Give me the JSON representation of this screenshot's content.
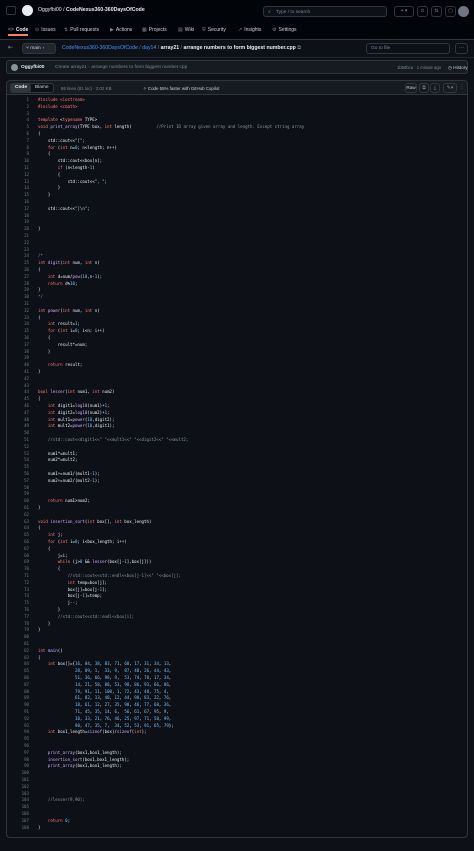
{
  "header": {
    "owner": "Oggyfbi00",
    "repo": "CodeNexus360-360DaysOfCode",
    "search_placeholder": "Type / to search",
    "plus_label": "+",
    "tabs": [
      {
        "icon": "<>",
        "label": "Code",
        "active": true
      },
      {
        "icon": "⊙",
        "label": "Issues",
        "active": false
      },
      {
        "icon": "⇅",
        "label": "Pull requests",
        "active": false
      },
      {
        "icon": "▶",
        "label": "Actions",
        "active": false
      },
      {
        "icon": "▦",
        "label": "Projects",
        "active": false
      },
      {
        "icon": "▤",
        "label": "Wiki",
        "active": false
      },
      {
        "icon": "⛨",
        "label": "Security",
        "active": false
      },
      {
        "icon": "↗",
        "label": "Insights",
        "active": false
      },
      {
        "icon": "⚙",
        "label": "Settings",
        "active": false
      }
    ]
  },
  "filebar": {
    "branch": "main",
    "path_repo": "CodeNexus360-360DaysOfCode",
    "path_dir": "day14",
    "path_dir2": "array21",
    "path_file": "arrange numbers to form biggest number.cpp",
    "goto_placeholder": "Go to file",
    "more": "···"
  },
  "commit": {
    "user": "Oggyfbi00",
    "message": "Create array21 - arrange numbers to form biggest number.cpp",
    "meta": "1b58bca · 1 minute ago",
    "history": "History"
  },
  "codeview": {
    "code_tab": "Code",
    "blame_tab": "Blame",
    "lines_info": "86 lines (81 loc) · 2.02 KB",
    "copilot": "Code 55% faster with GitHub Copilot",
    "raw": "Raw"
  },
  "code_lines": [
    "#include <iostream>",
    "#include <cmath>",
    "",
    "template <typename TYPE>",
    "void print_array(TYPE box, int length)          //Print 1D array given array and length. Except string array",
    "{",
    "    std::cout<<\"[\";",
    "    for (int n=0; n<length; n++)",
    "    {",
    "        std::cout<<box[n];",
    "        if (n<length-1)",
    "        {",
    "            std::cout<<\", \";",
    "        }",
    "    }",
    "",
    "    std::cout<<\"]\\n\";",
    "",
    "",
    "}",
    "",
    "",
    "",
    "/*",
    "int digit(int num, int n)",
    "{",
    "    int d=num/pow(10,n-1);",
    "    return d%10;",
    "}",
    "*/",
    "",
    "int power(int num, int n)",
    "{",
    "    int result=1;",
    "    for (int i=0; i<n; i++)",
    "    {",
    "        result*=num;",
    "    }",
    "",
    "    return result;",
    "}",
    "",
    "",
    "bool lesser(int num1, int num2)",
    "{",
    "    int digit1=log10(num1)+1;",
    "    int digit2=log10(num2)+1;",
    "    int mult1=power(10,digit2);",
    "    int mult2=power(10,digit1);",
    "",
    "    //std::cout<<digit1<<\" \"<<mult1<<\" \"<<digit2<<\" \"<<mult2;",
    "",
    "    num1*=mult1;",
    "    num2*=mult2;",
    "",
    "    num1+=num1/(mult1-1);",
    "    num2+=num2/(mult2-1);",
    "",
    "",
    "    return num1>num2;",
    "}",
    "",
    "void insertion_sort(int box[], int box_length)",
    "{",
    "    int j;",
    "    for (int i=0; i<box_length; i++)",
    "    {",
    "        j=i;",
    "        while (j>0 && lesser(box[j-1],box[j]))",
    "        {",
    "            //std::cout<<std::endl<<box[j-1]<<\" \"<<box[j];",
    "            int temp=box[j];",
    "            box[j]=box[j-1];",
    "            box[j-1]=temp;",
    "            j--;",
    "        }",
    "        //std::cout<<std::endl<<box[i];",
    "    }",
    "}",
    "",
    "",
    "int main()",
    "{",
    "    int box[]={16, 84, 38, 83, 71, 68, 17, 31, 34, 13,",
    "               28, 89, 1,  33, 9,  87, 48, 26, 44, 43,",
    "               51, 36, 66, 98, 9,  53, 74, 78, 17, 34,",
    "               14, 21, 58, 88, 53, 98, 86, 93, 66, 86,",
    "               79, 91, 11, 100, 1, 72, 43, 48, 75, 4,",
    "               61, 82, 13, 48, 12, 44, 98, 83, 22, 76,",
    "               18, 61, 12, 27, 35, 98, 46, 77, 68, 36,",
    "               71, 45, 35, 14, 6,  56, 61, 67, 95, 9,",
    "               10, 33, 21, 76, 46, 25, 97, 71, 58, 99,",
    "               90, 47, 35, 7,  34, 52, 53, 91, 65, 79};",
    "    int box1_length=sizeof(box)/sizeof(int);",
    "",
    "",
    "    print_array(box1,box1_length);",
    "    insertion_sort(box1,box1_length);",
    "    print_array(box1,box1_length);",
    "",
    "",
    "",
    "",
    "    //lesser(9,90);",
    "",
    "",
    "    return 0;",
    "}"
  ]
}
